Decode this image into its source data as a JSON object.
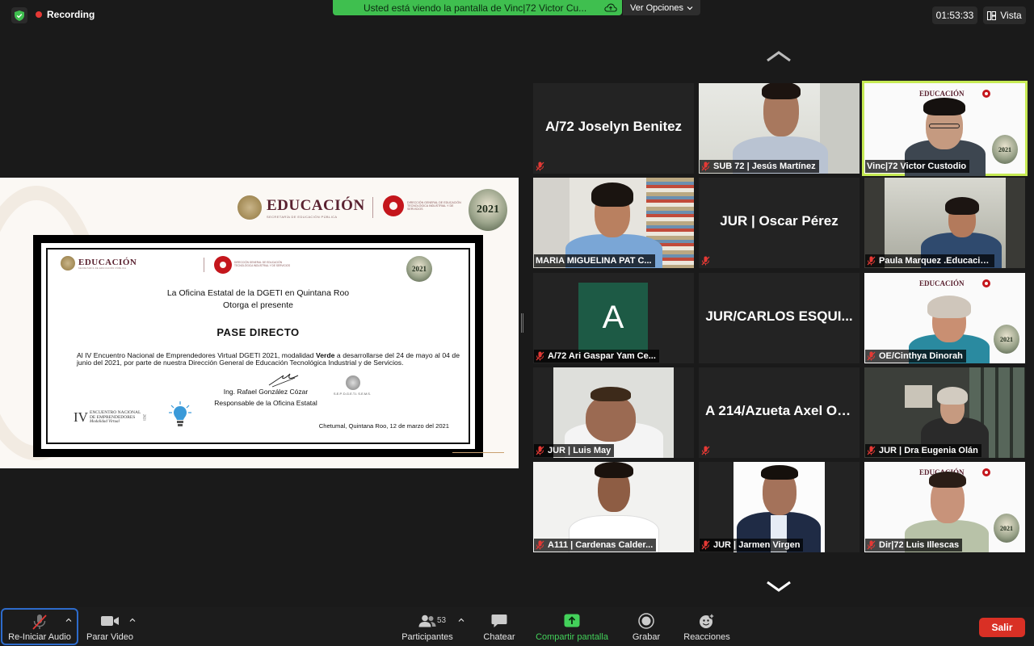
{
  "top_bar": {
    "recording_label": "Recording",
    "share_banner": "Usted está viendo la pantalla de Vinc|72 Victor Cu...",
    "view_options": "Ver Opciones",
    "timer": "01:53:33",
    "view_label": "Vista"
  },
  "shared_screen": {
    "header_edu": "EDUCACIÓN",
    "header_edu_sub": "SECRETARÍA DE EDUCACIÓN PÚBLICA",
    "header_dgeti": "DIRECCIÓN GENERAL DE EDUCACIÓN TECNOLÓGICA INDUSTRIAL Y DE SERVICIOS",
    "header_mexico": "2021",
    "certificate": {
      "line1": "La Oficina Estatal de la DGETI en Quintana Roo",
      "line2": "Otorga el presente",
      "title": "PASE DIRECTO",
      "body_pre": "Al IV Encuentro Nacional de Emprendedores Virtual DGETI 2021, modalidad ",
      "body_bold": "Verde",
      "body_post": " a desarrollarse  del 24 de mayo al 04 de junio del 2021, por parte de nuestra Dirección General de Educación Tecnológica Industrial y de Servicios.",
      "signer": "Ing. Rafael González Cózar",
      "signer_role": "Responsable de la Oficina Estatal",
      "seal_text": "S.E.P.   D.G.E.T.I.   S.E.M.S.",
      "date": "Chetumal, Quintana Roo, 12 de marzo del 2021",
      "iv_numeral": "IV",
      "iv_text1": "ENCUENTRO NACIONAL",
      "iv_text2": "DE EMPRENDEDORES",
      "iv_text3": "Modalidad Virtual",
      "iv_year": "2021"
    }
  },
  "participants": [
    {
      "name": "A/72 Joselyn Benitez",
      "video": false
    },
    {
      "name": "SUB 72 | Jesús Martínez",
      "video": true
    },
    {
      "name": "Vinc|72 Victor Custodio",
      "video": true,
      "active": true
    },
    {
      "name": "MARIA MIGUELINA PAT C...",
      "video": true
    },
    {
      "name": "JUR | Oscar Pérez",
      "video": false
    },
    {
      "name": "Paula Marquez .Educacio...",
      "video": true
    },
    {
      "name": "A/72 Ari Gaspar Yam Ce...",
      "video": false,
      "avatar_letter": "A"
    },
    {
      "name": "JUR/CARLOS ESQUI...",
      "video": false
    },
    {
      "name": "OE/Cinthya Dinorah",
      "video": true
    },
    {
      "name": "JUR | Luis May",
      "video": true
    },
    {
      "name": "A 214/Azueta Axel Os...",
      "video": false
    },
    {
      "name": "JUR | Dra Eugenia Olán",
      "video": true
    },
    {
      "name": "A111 | Cardenas Calder...",
      "video": true
    },
    {
      "name": "JUR | Jarmen Virgen",
      "video": true
    },
    {
      "name": "Dir|72 Luis Illescas",
      "video": true
    }
  ],
  "tile_logo": {
    "edu": "EDUCACIÓN",
    "year": "2021"
  },
  "toolbar": {
    "audio": "Re-Iniciar Audio",
    "video": "Parar Video",
    "participants": "Participantes",
    "participants_count": "53",
    "chat": "Chatear",
    "share": "Compartir pantalla",
    "record": "Grabar",
    "reactions": "Reacciones",
    "leave": "Salir"
  },
  "colors": {
    "share_banner": "#3fbf4f",
    "active_speaker": "#c6ea54",
    "leave": "#d93025",
    "audio_focus": "#2d6bcb",
    "share_icon": "#43d15a",
    "muted_mic": "#e53935"
  }
}
